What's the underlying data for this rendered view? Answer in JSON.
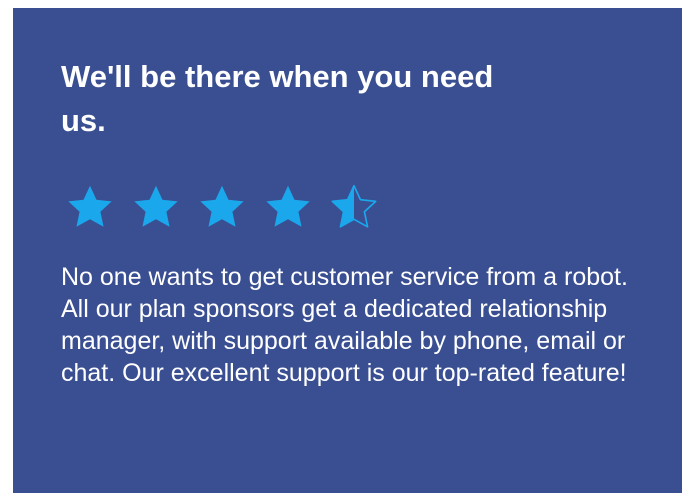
{
  "card": {
    "headline": "We'll be there when you need us.",
    "body": "No one wants to get customer service from a robot. All our plan sponsors get a dedicated relationship manager, with support available by phone, email or chat. Our excellent support is our top-rated feature!"
  },
  "rating": {
    "value": 4.5,
    "max": 5,
    "star_icon": "star-icon",
    "star_color": "#1aa7ec"
  },
  "colors": {
    "card_background": "#3a4f92",
    "text": "#ffffff"
  }
}
